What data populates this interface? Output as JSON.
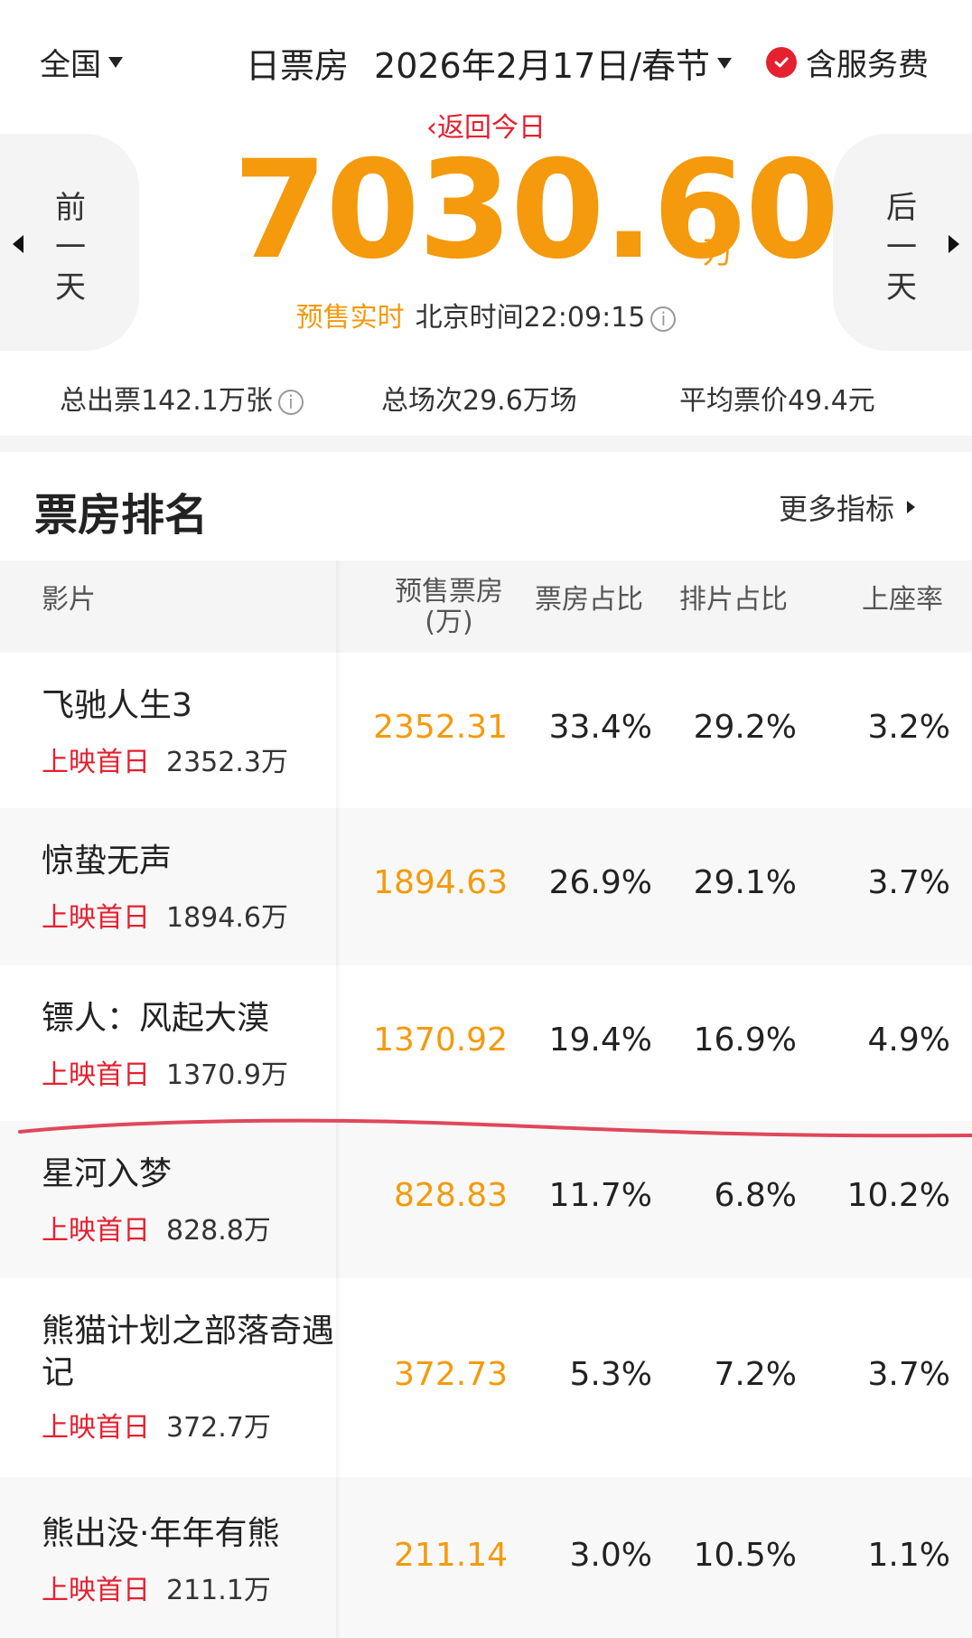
{
  "header": {
    "region": "全国",
    "title": "日票房",
    "date": "2026年2月17日/春节",
    "service_fee": "含服务费"
  },
  "hero": {
    "back_today": "返回今日",
    "prev_day": "前一天",
    "next_day": "后一天",
    "total": "7030.60",
    "unit": "万",
    "presale_label": "预售实时",
    "time_label": "北京时间22:09:15"
  },
  "stats": {
    "tickets": "总出票142.1万张",
    "shows": "总场次29.6万场",
    "avg_price": "平均票价49.4元"
  },
  "ranking": {
    "title": "票房排名",
    "more": "更多指标",
    "columns": {
      "film": "影片",
      "gross": "预售票房",
      "gross_unit": "(万)",
      "share": "票房占比",
      "schedule": "排片占比",
      "occupancy": "上座率"
    },
    "first_day_label": "上映首日",
    "rows": [
      {
        "name": "飞驰人生3",
        "first_day": "2352.3万",
        "gross": "2352.31",
        "share": "33.4%",
        "schedule": "29.2%",
        "occupancy": "3.2%"
      },
      {
        "name": "惊蛰无声",
        "first_day": "1894.6万",
        "gross": "1894.63",
        "share": "26.9%",
        "schedule": "29.1%",
        "occupancy": "3.7%"
      },
      {
        "name": "镖人：风起大漠",
        "first_day": "1370.9万",
        "gross": "1370.92",
        "share": "19.4%",
        "schedule": "16.9%",
        "occupancy": "4.9%"
      },
      {
        "name": "星河入梦",
        "first_day": "828.8万",
        "gross": "828.83",
        "share": "11.7%",
        "schedule": "6.8%",
        "occupancy": "10.2%"
      },
      {
        "name": "熊猫计划之部落奇遇记",
        "first_day": "372.7万",
        "gross": "372.73",
        "share": "5.3%",
        "schedule": "7.2%",
        "occupancy": "3.7%"
      },
      {
        "name": "熊出没·年年有熊",
        "first_day": "211.1万",
        "gross": "211.14",
        "share": "3.0%",
        "schedule": "10.5%",
        "occupancy": "1.1%"
      }
    ]
  },
  "colors": {
    "accent_orange": "#f49a0c",
    "accent_red": "#e5202f"
  },
  "icons": [
    "triangle-down-icon",
    "check-circle-icon",
    "chevron-left-icon",
    "info-icon",
    "triangle-left-icon",
    "triangle-right-icon"
  ]
}
